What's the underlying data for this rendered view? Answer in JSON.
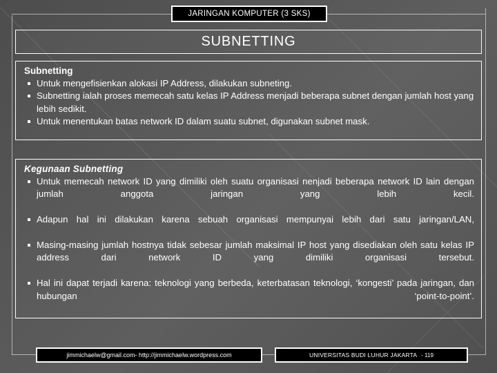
{
  "banner": {
    "course_title": "JARINGAN KOMPUTER (3 SKS)"
  },
  "heading": {
    "title": "SUBNETTING"
  },
  "sections": [
    {
      "title": "Subnetting",
      "italic": false,
      "bullets": [
        "Untuk mengefisienkan alokasi IP Address, dilakukan subneting.",
        "Subnetting ialah proses memecah satu kelas IP Address menjadi beberapa subnet dengan jumlah host yang lebih sedikit.",
        "Untuk menentukan batas network ID dalam suatu subnet, digunakan subnet mask."
      ]
    },
    {
      "title": "Kegunaan Subnetting",
      "italic": true,
      "bullets": [
        "Untuk memecah network ID yang dimiliki oleh suatu organisasi nenjadi beberapa network ID lain dengan jumlah anggota jaringan yang lebih kecil.",
        "Adapun hal ini dilakukan karena sebuah organisasi mempunyai lebih dari satu jaringan/LAN,",
        "Masing-masing jumlah hostnya tidak sebesar jumlah maksimal IP host yang disediakan oleh satu kelas IP address dari network ID yang dimiliki organisasi tersebut.",
        "Hal ini dapat terjadi karena: teknologi yang berbeda, keterbatasan teknologi, ‘kongesti’ pada jaringan, dan hubungan ‘point-to-point’."
      ]
    }
  ],
  "footer": {
    "contact": "jimmichaelw@gmail.com- http://jimmichaelw.wordpress.com",
    "institution": "UNIVERSITAS BUDI LUHUR JAKARTA",
    "page_number": "- 119"
  },
  "colors": {
    "background_dark": "#4d4d4d",
    "background_light": "#5e5e5e",
    "text": "#ffffff",
    "banner_fill": "#000000",
    "border": "#ffffff"
  }
}
